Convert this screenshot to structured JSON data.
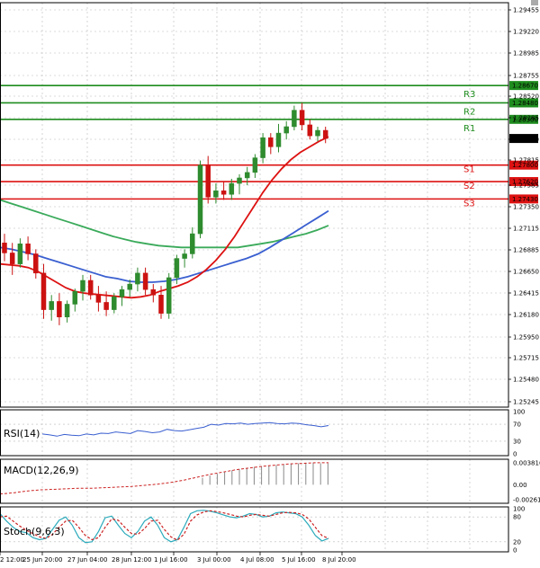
{
  "colors": {
    "grid": "#b8b8b8",
    "bull": "#2e8b2e",
    "bear": "#cc1111",
    "resistance": "#1e8c1e",
    "support": "#dd1111",
    "ma_fast": "#dd1111",
    "ma_mid": "#3a5fd0",
    "ma_slow": "#3aaa5a",
    "rsi": "#3a5fd0",
    "macd_signal": "#cc2222",
    "stoch_k": "#2aaabb",
    "stoch_d": "#cc2222",
    "price_box": "#000000"
  },
  "chart_data": [
    {
      "type": "candlestick",
      "title": "",
      "x_tick_labels": [
        "2 12:00",
        "25 Jun 20:00",
        "27 Jun 04:00",
        "28 Jun 12:00",
        "1 Jul 16:00",
        "3 Jul 00:00",
        "4 Jul 08:00",
        "5 Jul 16:00",
        "8 Jul 20:00"
      ],
      "y_tick_labels": [
        "1.29455",
        "1.29220",
        "1.28985",
        "1.28755",
        "1.28520",
        "1.28285",
        "1.28050",
        "1.27815",
        "1.27585",
        "1.27350",
        "1.27115",
        "1.26885",
        "1.26650",
        "1.26415",
        "1.26180",
        "1.25950",
        "1.25715",
        "1.25480",
        "1.25245"
      ],
      "ylim": [
        1.25155,
        1.29575
      ],
      "current_price": "1.28091",
      "levels": [
        {
          "name": "R3",
          "value": 1.2867,
          "label": "1.28670",
          "kind": "resistance"
        },
        {
          "name": "R2",
          "value": 1.2848,
          "label": "1.28480",
          "kind": "resistance"
        },
        {
          "name": "R1",
          "value": 1.283,
          "label": "1.28300",
          "kind": "resistance"
        },
        {
          "name": "S1",
          "value": 1.278,
          "label": "1.27800",
          "kind": "support"
        },
        {
          "name": "S2",
          "value": 1.2762,
          "label": "1.27620",
          "kind": "support"
        },
        {
          "name": "S3",
          "value": 1.2743,
          "label": "1.27430",
          "kind": "support"
        }
      ],
      "candles": [
        [
          1.2695,
          1.2705,
          1.2675,
          1.2684
        ],
        [
          1.2684,
          1.2695,
          1.266,
          1.2672
        ],
        [
          1.2672,
          1.27,
          1.2668,
          1.2694
        ],
        [
          1.2694,
          1.2702,
          1.2676,
          1.2683
        ],
        [
          1.2683,
          1.2688,
          1.2656,
          1.2662
        ],
        [
          1.2662,
          1.2672,
          1.2612,
          1.2622
        ],
        [
          1.2622,
          1.2638,
          1.261,
          1.2631
        ],
        [
          1.2631,
          1.264,
          1.2605,
          1.2614
        ],
        [
          1.2614,
          1.2632,
          1.2608,
          1.2628
        ],
        [
          1.2628,
          1.2645,
          1.262,
          1.2642
        ],
        [
          1.2642,
          1.266,
          1.2632,
          1.2654
        ],
        [
          1.2654,
          1.266,
          1.2633,
          1.2638
        ],
        [
          1.2638,
          1.2648,
          1.262,
          1.263
        ],
        [
          1.263,
          1.2642,
          1.2615,
          1.2622
        ],
        [
          1.2622,
          1.264,
          1.2618,
          1.2636
        ],
        [
          1.2636,
          1.2648,
          1.2626,
          1.2644
        ],
        [
          1.2644,
          1.2655,
          1.2636,
          1.265
        ],
        [
          1.265,
          1.2668,
          1.2642,
          1.2662
        ],
        [
          1.2662,
          1.2668,
          1.2638,
          1.2644
        ],
        [
          1.2644,
          1.265,
          1.263,
          1.2638
        ],
        [
          1.2638,
          1.2648,
          1.2612,
          1.2618
        ],
        [
          1.2618,
          1.2662,
          1.2612,
          1.2657
        ],
        [
          1.2657,
          1.2682,
          1.265,
          1.2678
        ],
        [
          1.2678,
          1.2688,
          1.2668,
          1.2683
        ],
        [
          1.2683,
          1.2712,
          1.2678,
          1.2705
        ],
        [
          1.2705,
          1.2785,
          1.27,
          1.278
        ],
        [
          1.278,
          1.279,
          1.2738,
          1.2745
        ],
        [
          1.2745,
          1.276,
          1.2738,
          1.2752
        ],
        [
          1.2752,
          1.2762,
          1.2742,
          1.2748
        ],
        [
          1.2748,
          1.2765,
          1.2742,
          1.276
        ],
        [
          1.276,
          1.277,
          1.2748,
          1.2766
        ],
        [
          1.2766,
          1.2778,
          1.2758,
          1.2772
        ],
        [
          1.2772,
          1.2792,
          1.2766,
          1.2788
        ],
        [
          1.2788,
          1.2815,
          1.2782,
          1.281
        ],
        [
          1.281,
          1.2815,
          1.2792,
          1.28
        ],
        [
          1.28,
          1.2825,
          1.2794,
          1.2815
        ],
        [
          1.2815,
          1.2828,
          1.2808,
          1.2822
        ],
        [
          1.2822,
          1.2845,
          1.2818,
          1.284
        ],
        [
          1.284,
          1.2848,
          1.2818,
          1.2824
        ],
        [
          1.2824,
          1.283,
          1.2808,
          1.2812
        ],
        [
          1.2812,
          1.2822,
          1.2806,
          1.2818
        ],
        [
          1.2818,
          1.2822,
          1.2804,
          1.2809
        ]
      ],
      "ma_fast": [
        1.2672,
        1.2671,
        1.267,
        1.2668,
        1.2664,
        1.2658,
        1.2652,
        1.2646,
        1.2642,
        1.264,
        1.2639,
        1.2638,
        1.2637,
        1.2636,
        1.2635,
        1.2636,
        1.2638,
        1.2642,
        1.2645,
        1.2648,
        1.2652,
        1.2658,
        1.2666,
        1.2676,
        1.2688,
        1.2702,
        1.2718,
        1.2734,
        1.275,
        1.2764,
        1.2776,
        1.2786,
        1.2794,
        1.28,
        1.2806,
        1.2811
      ],
      "ma_mid": [
        1.269,
        1.2688,
        1.2685,
        1.2682,
        1.2678,
        1.2674,
        1.267,
        1.2666,
        1.2662,
        1.2658,
        1.2656,
        1.2653,
        1.2652,
        1.2652,
        1.2653,
        1.2655,
        1.2658,
        1.2662,
        1.2666,
        1.267,
        1.2674,
        1.2678,
        1.2683,
        1.269,
        1.2698,
        1.2706,
        1.2714,
        1.2722,
        1.273
      ],
      "ma_slow": [
        1.2742,
        1.2738,
        1.2734,
        1.273,
        1.2726,
        1.2722,
        1.2718,
        1.2714,
        1.271,
        1.2706,
        1.2702,
        1.2699,
        1.2696,
        1.2694,
        1.2692,
        1.2691,
        1.269,
        1.269,
        1.269,
        1.269,
        1.269,
        1.269,
        1.2692,
        1.2694,
        1.2696,
        1.2699,
        1.2702,
        1.2705,
        1.2709,
        1.2714
      ]
    },
    {
      "type": "line",
      "title": "RSI(14)",
      "y_tick_labels": [
        "100",
        "70",
        "30",
        "0"
      ],
      "ylim": [
        0,
        100
      ],
      "values": [
        47,
        45,
        42,
        46,
        44,
        43,
        47,
        45,
        49,
        48,
        52,
        50,
        48,
        55,
        53,
        50,
        52,
        58,
        55,
        54,
        57,
        60,
        63,
        70,
        68,
        72,
        71,
        73,
        70,
        72,
        73,
        74,
        72,
        71,
        73,
        72,
        69,
        67,
        64,
        67
      ]
    },
    {
      "type": "bar",
      "title": "MACD(12,26,9)",
      "y_tick_labels": [
        "0.003816",
        "0.00",
        "-0.002617"
      ],
      "ylim": [
        -0.0029,
        0.0041
      ],
      "histogram": [
        0.0012,
        0.0016,
        0.0019,
        0.0022,
        0.0025,
        0.0027,
        0.0029,
        0.0031,
        0.0032,
        0.0033,
        0.0034,
        0.0035,
        0.0036,
        0.0037,
        0.0038,
        0.0038,
        0.0037,
        0.0037
      ],
      "signal": [
        -0.0016,
        -0.0014,
        -0.0011,
        -0.0009,
        -0.0008,
        -0.0007,
        -0.0006,
        -0.0006,
        -0.0005,
        -0.0004,
        -0.0003,
        -0.0001,
        0.0001,
        0.0004,
        0.0008,
        0.0013,
        0.0018,
        0.0022,
        0.0026,
        0.0029,
        0.0032,
        0.0034,
        0.0036,
        0.0037,
        0.0038,
        0.0038
      ]
    },
    {
      "type": "line",
      "title": "Stoch(9,6,3)",
      "y_tick_labels": [
        "100",
        "80",
        "20",
        "0"
      ],
      "ylim": [
        0,
        100
      ],
      "stoch_k": [
        88,
        70,
        55,
        45,
        42,
        30,
        25,
        28,
        50,
        72,
        80,
        60,
        30,
        18,
        20,
        45,
        78,
        82,
        60,
        40,
        30,
        45,
        70,
        80,
        60,
        30,
        20,
        25,
        55,
        88,
        95,
        96,
        94,
        90,
        85,
        80,
        78,
        82,
        88,
        86,
        80,
        82,
        90,
        92,
        90,
        88,
        80,
        60,
        35,
        22,
        28
      ],
      "stoch_d": [
        80,
        82,
        70,
        58,
        48,
        40,
        32,
        28,
        38,
        55,
        70,
        72,
        55,
        35,
        25,
        30,
        55,
        75,
        72,
        55,
        40,
        38,
        52,
        70,
        72,
        50,
        32,
        24,
        38,
        70,
        85,
        92,
        95,
        93,
        90,
        86,
        82,
        80,
        84,
        86,
        84,
        82,
        86,
        90,
        91,
        90,
        86,
        75,
        55,
        35,
        28
      ]
    }
  ]
}
